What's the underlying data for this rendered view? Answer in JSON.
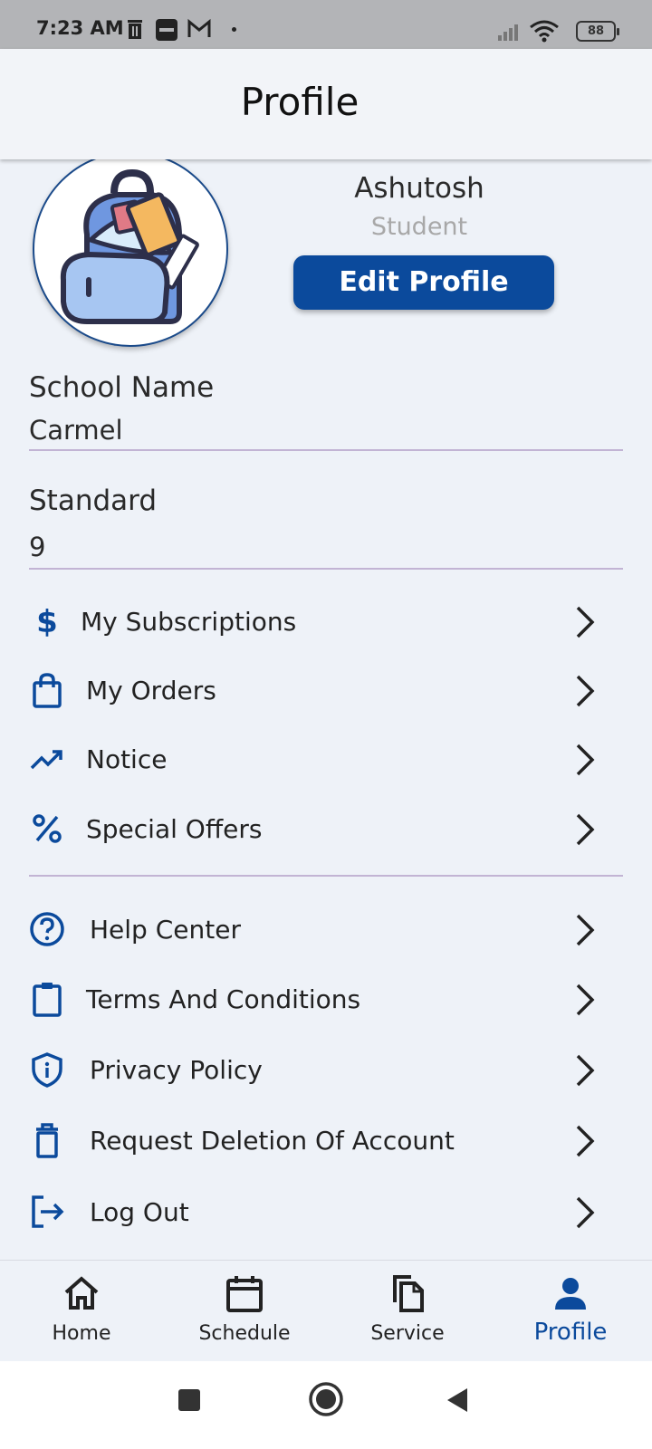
{
  "status_bar": {
    "time": "7:23 AM",
    "battery": "88"
  },
  "header": {
    "title": "Profile"
  },
  "profile": {
    "name": "Ashutosh",
    "role": "Student",
    "edit_label": "Edit Profile"
  },
  "fields": [
    {
      "label": "School Name",
      "value": "Carmel"
    },
    {
      "label": "Standard",
      "value": "9"
    }
  ],
  "menu": [
    {
      "label": "My Subscriptions",
      "icon": "dollar-icon"
    },
    {
      "label": "My Orders",
      "icon": "shopping-bag-icon"
    },
    {
      "label": "Notice",
      "icon": "trending-icon"
    },
    {
      "label": "Special Offers",
      "icon": "percent-icon"
    }
  ],
  "menu2": [
    {
      "label": "Help Center",
      "icon": "help-circle-icon"
    },
    {
      "label": "Terms And Conditions",
      "icon": "clipboard-icon"
    },
    {
      "label": "Privacy Policy",
      "icon": "shield-icon"
    },
    {
      "label": "Request Deletion Of Account",
      "icon": "trash-icon"
    },
    {
      "label": "Log Out",
      "icon": "logout-icon"
    }
  ],
  "bottom_nav": [
    {
      "label": "Home",
      "icon": "home-icon",
      "active": false
    },
    {
      "label": "Schedule",
      "icon": "calendar-icon",
      "active": false
    },
    {
      "label": "Service",
      "icon": "copy-icon",
      "active": false
    },
    {
      "label": "Profile",
      "icon": "person-icon",
      "active": true
    }
  ],
  "colors": {
    "accent": "#0b4a9c",
    "background": "#eef2f8",
    "divider": "#c2b4d4"
  }
}
